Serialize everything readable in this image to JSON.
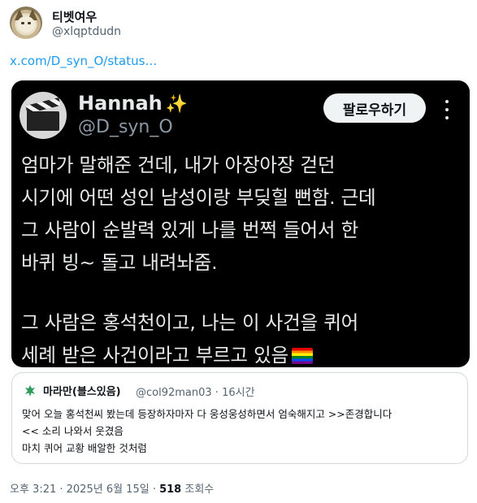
{
  "tweet": {
    "author_name": "티벳여우",
    "author_handle": "@xlqptdudn",
    "link_text": "x.com/D_syn_O/status…",
    "timestamp": "오후 3:21 · 2025년 6월 15일",
    "separator": " · ",
    "view_count": "518",
    "view_label": " 조회수"
  },
  "embedded_card": {
    "name": "Hannah",
    "name_emoji": "✨",
    "handle": "@D_syn_O",
    "follow_label": "팔로우하기",
    "paragraph1": [
      "엄마가 말해준 건데, 내가 아장아장 걷던",
      "시기에 어떤 성인 남성이랑 부딪힐 뻔함. 근데",
      "그 사람이 순발력 있게 나를 번쩍 들어서 한",
      "바퀴 빙~ 돌고 내려놔줌."
    ],
    "paragraph2": [
      "그 사람은 홍석천이고, 나는 이 사건을 퀴어",
      "세례 받은 사건이라고 부르고 있음"
    ]
  },
  "quote": {
    "name": "마라만(블스있음)",
    "handle": "@col92man03",
    "time": "16시간",
    "lines": [
      "맞어 오늘 홍석천씨 봤는데 등장하자마자 다 웅성웅성하면서 엄숙해지고 >>존경합니다",
      "<< 소리 나와서 웃겼음",
      "마치 퀴어 교황 배알한 것처럼"
    ]
  },
  "colors": {
    "link": "#1d9bf0",
    "card_bg": "#000000",
    "muted": "#536471"
  }
}
